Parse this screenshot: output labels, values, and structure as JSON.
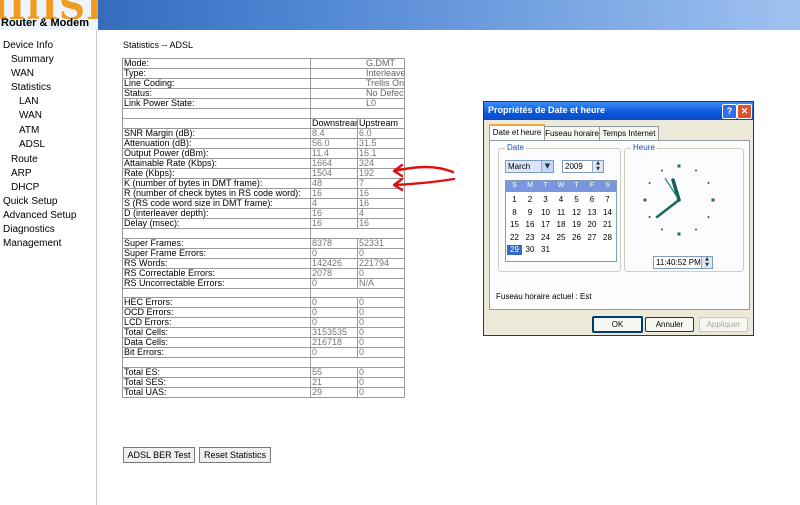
{
  "header": {
    "logo_big": "lIlISL",
    "logo_text": "Router & Modem"
  },
  "nav": {
    "items": [
      {
        "label": "Device Info"
      },
      {
        "label": "Summary"
      },
      {
        "label": "WAN"
      },
      {
        "label": "Statistics"
      },
      {
        "label": "LAN"
      },
      {
        "label": "WAN"
      },
      {
        "label": "ATM"
      },
      {
        "label": "ADSL"
      },
      {
        "label": "Route"
      },
      {
        "label": "ARP"
      },
      {
        "label": "DHCP"
      },
      {
        "label": "Quick Setup"
      },
      {
        "label": "Advanced Setup"
      },
      {
        "label": "Diagnostics"
      },
      {
        "label": "Management"
      }
    ]
  },
  "main": {
    "title": "Statistics -- ADSL",
    "top_rows": [
      [
        "Mode:",
        "G.DMT"
      ],
      [
        "Type:",
        "Interleave"
      ],
      [
        "Line Coding:",
        "Trellis On"
      ],
      [
        "Status:",
        "No Defect"
      ],
      [
        "Link Power State:",
        "L0"
      ]
    ],
    "col_headers": [
      "",
      "Downstream",
      "Upstream"
    ],
    "rows_a": [
      [
        "SNR Margin (dB):",
        "8.4",
        "6.0"
      ],
      [
        "Attenuation (dB):",
        "56.0",
        "31.5"
      ],
      [
        "Output Power (dBm):",
        "11.4",
        "16.1"
      ],
      [
        "Attainable Rate (Kbps):",
        "1664",
        "324"
      ],
      [
        "Rate (Kbps):",
        "1504",
        "192"
      ],
      [
        "K (number of bytes in DMT frame):",
        "48",
        "7"
      ],
      [
        "R (number of check bytes in RS code word):",
        "16",
        "16"
      ],
      [
        "S (RS code word size in DMT frame):",
        "4",
        "16"
      ],
      [
        "D (interleaver depth):",
        "16",
        "4"
      ],
      [
        "Delay (msec):",
        "16",
        "16"
      ]
    ],
    "rows_b": [
      [
        "Super Frames:",
        "8378",
        "52331"
      ],
      [
        "Super Frame Errors:",
        "0",
        "0"
      ],
      [
        "RS Words:",
        "142426",
        "221794"
      ],
      [
        "RS Correctable Errors:",
        "2078",
        "0"
      ],
      [
        "RS Uncorrectable Errors:",
        "0",
        "N/A"
      ]
    ],
    "rows_c": [
      [
        "HEC Errors:",
        "0",
        "0"
      ],
      [
        "OCD Errors:",
        "0",
        "0"
      ],
      [
        "LCD Errors:",
        "0",
        "0"
      ],
      [
        "Total Cells:",
        "3153535",
        "0"
      ],
      [
        "Data Cells:",
        "216718",
        "0"
      ],
      [
        "Bit Errors:",
        "0",
        "0"
      ]
    ],
    "rows_d": [
      [
        "Total ES:",
        "55",
        "0"
      ],
      [
        "Total SES:",
        "21",
        "0"
      ],
      [
        "Total UAS:",
        "29",
        "0"
      ]
    ],
    "buttons": {
      "ber": "ADSL BER Test",
      "reset": "Reset Statistics"
    },
    "annotation_color": "#e01010"
  },
  "dialog": {
    "title": "Propriétés de Date et heure",
    "help": "?",
    "close": "✕",
    "tabs": [
      "Date et heure",
      "Fuseau horaire",
      "Temps Internet"
    ],
    "date_group": "Date",
    "time_group": "Heure",
    "month": "March",
    "year": "2009",
    "weekdays": [
      "S",
      "M",
      "T",
      "W",
      "T",
      "F",
      "S"
    ],
    "calendar_rows": [
      [
        "1",
        "2",
        "3",
        "4",
        "5",
        "6",
        "7"
      ],
      [
        "8",
        "9",
        "10",
        "11",
        "12",
        "13",
        "14"
      ],
      [
        "15",
        "16",
        "17",
        "18",
        "19",
        "20",
        "21"
      ],
      [
        "22",
        "23",
        "24",
        "25",
        "26",
        "27",
        "28"
      ],
      [
        "29",
        "30",
        "31",
        "",
        "",
        "",
        ""
      ]
    ],
    "selected_day": "29",
    "time": "11:40:52 PM",
    "timezone_status": "Fuseau horaire actuel : Est",
    "ok": "OK",
    "cancel": "Annuler",
    "apply": "Appliquer",
    "accent": "#316ac5"
  }
}
